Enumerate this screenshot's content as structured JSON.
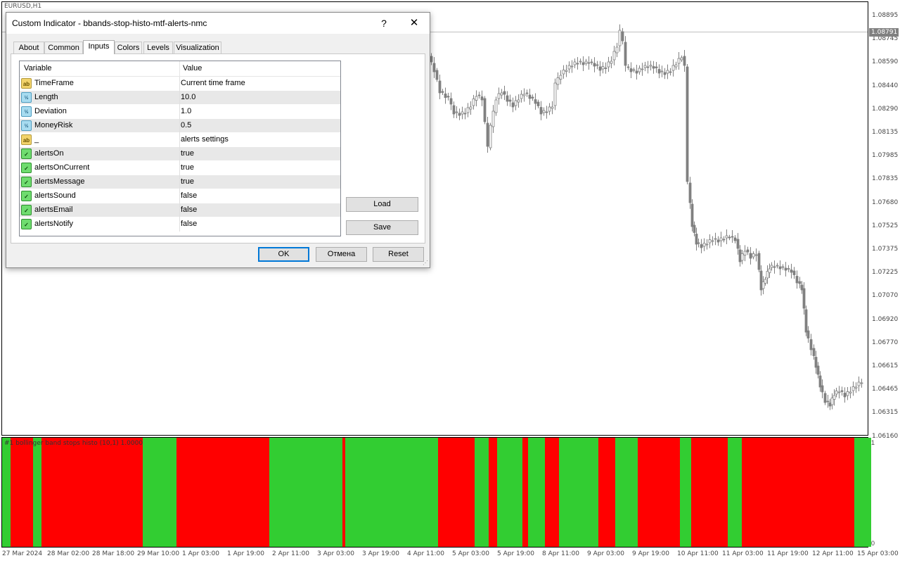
{
  "chart": {
    "symbol": "EURUSD,H1",
    "current_price": "1.08791",
    "price_ticks": [
      "1.08895",
      "1.08745",
      "1.08590",
      "1.08440",
      "1.08290",
      "1.08135",
      "1.07985",
      "1.07835",
      "1.07680",
      "1.07525",
      "1.07375",
      "1.07225",
      "1.07070",
      "1.06920",
      "1.06770",
      "1.06615",
      "1.06465",
      "1.06315",
      "1.06160"
    ],
    "time_ticks": [
      "27 Mar 2024",
      "28 Mar 02:00",
      "28 Mar 18:00",
      "29 Mar 10:00",
      "1 Apr 03:00",
      "1 Apr 19:00",
      "2 Apr 11:00",
      "3 Apr 03:00",
      "3 Apr 19:00",
      "4 Apr 11:00",
      "5 Apr 03:00",
      "5 Apr 19:00",
      "8 Apr 11:00",
      "9 Apr 03:00",
      "9 Apr 19:00",
      "10 Apr 11:00",
      "11 Apr 03:00",
      "11 Apr 19:00",
      "12 Apr 11:00",
      "15 Apr 03:00"
    ],
    "colors": {
      "bull": "#32cd32",
      "bear": "#ff0000",
      "candle": "#808080"
    }
  },
  "indicator": {
    "label": "#1  bollinger band stops histo (10,1) 1.0000",
    "max_label": "1",
    "min_label": "0",
    "segments": [
      {
        "color": "green",
        "w": 12
      },
      {
        "color": "red",
        "w": 32
      },
      {
        "color": "green",
        "w": 12
      },
      {
        "color": "red",
        "w": 144
      },
      {
        "color": "green",
        "w": 48
      },
      {
        "color": "red",
        "w": 132
      },
      {
        "color": "green",
        "w": 104
      },
      {
        "color": "red",
        "w": 4
      },
      {
        "color": "green",
        "w": 132
      },
      {
        "color": "red",
        "w": 52
      },
      {
        "color": "green",
        "w": 20
      },
      {
        "color": "red",
        "w": 12
      },
      {
        "color": "green",
        "w": 36
      },
      {
        "color": "red",
        "w": 8
      },
      {
        "color": "green",
        "w": 24
      },
      {
        "color": "red",
        "w": 20
      },
      {
        "color": "green",
        "w": 56
      },
      {
        "color": "red",
        "w": 24
      },
      {
        "color": "green",
        "w": 32
      },
      {
        "color": "red",
        "w": 60
      },
      {
        "color": "green",
        "w": 16
      },
      {
        "color": "red",
        "w": 52
      },
      {
        "color": "green",
        "w": 20
      },
      {
        "color": "red",
        "w": 160
      },
      {
        "color": "green",
        "w": 24
      }
    ]
  },
  "dialog": {
    "title": "Custom Indicator - bbands-stop-histo-mtf-alerts-nmc",
    "help_label": "?",
    "close_label": "✕",
    "tabs": [
      "About",
      "Common",
      "Inputs",
      "Colors",
      "Levels",
      "Visualization"
    ],
    "active_tab": "Inputs",
    "columns": {
      "variable": "Variable",
      "value": "Value"
    },
    "params": [
      {
        "icon": "ab",
        "name": "TimeFrame",
        "value": "Current time frame"
      },
      {
        "icon": "num",
        "name": "Length",
        "value": "10.0"
      },
      {
        "icon": "num",
        "name": "Deviation",
        "value": "1.0"
      },
      {
        "icon": "num",
        "name": "MoneyRisk",
        "value": "0.5"
      },
      {
        "icon": "ab",
        "name": "_",
        "value": "alerts settings"
      },
      {
        "icon": "bool",
        "name": "alertsOn",
        "value": "true"
      },
      {
        "icon": "bool",
        "name": "alertsOnCurrent",
        "value": "true"
      },
      {
        "icon": "bool",
        "name": "alertsMessage",
        "value": "true"
      },
      {
        "icon": "bool",
        "name": "alertsSound",
        "value": "false"
      },
      {
        "icon": "bool",
        "name": "alertsEmail",
        "value": "false"
      },
      {
        "icon": "bool",
        "name": "alertsNotify",
        "value": "false"
      }
    ],
    "icon_text": {
      "ab": "ab",
      "num": "½",
      "bool": "✓"
    },
    "buttons": {
      "load": "Load",
      "save": "Save",
      "ok": "OK",
      "cancel": "Отмена",
      "reset": "Reset"
    }
  }
}
